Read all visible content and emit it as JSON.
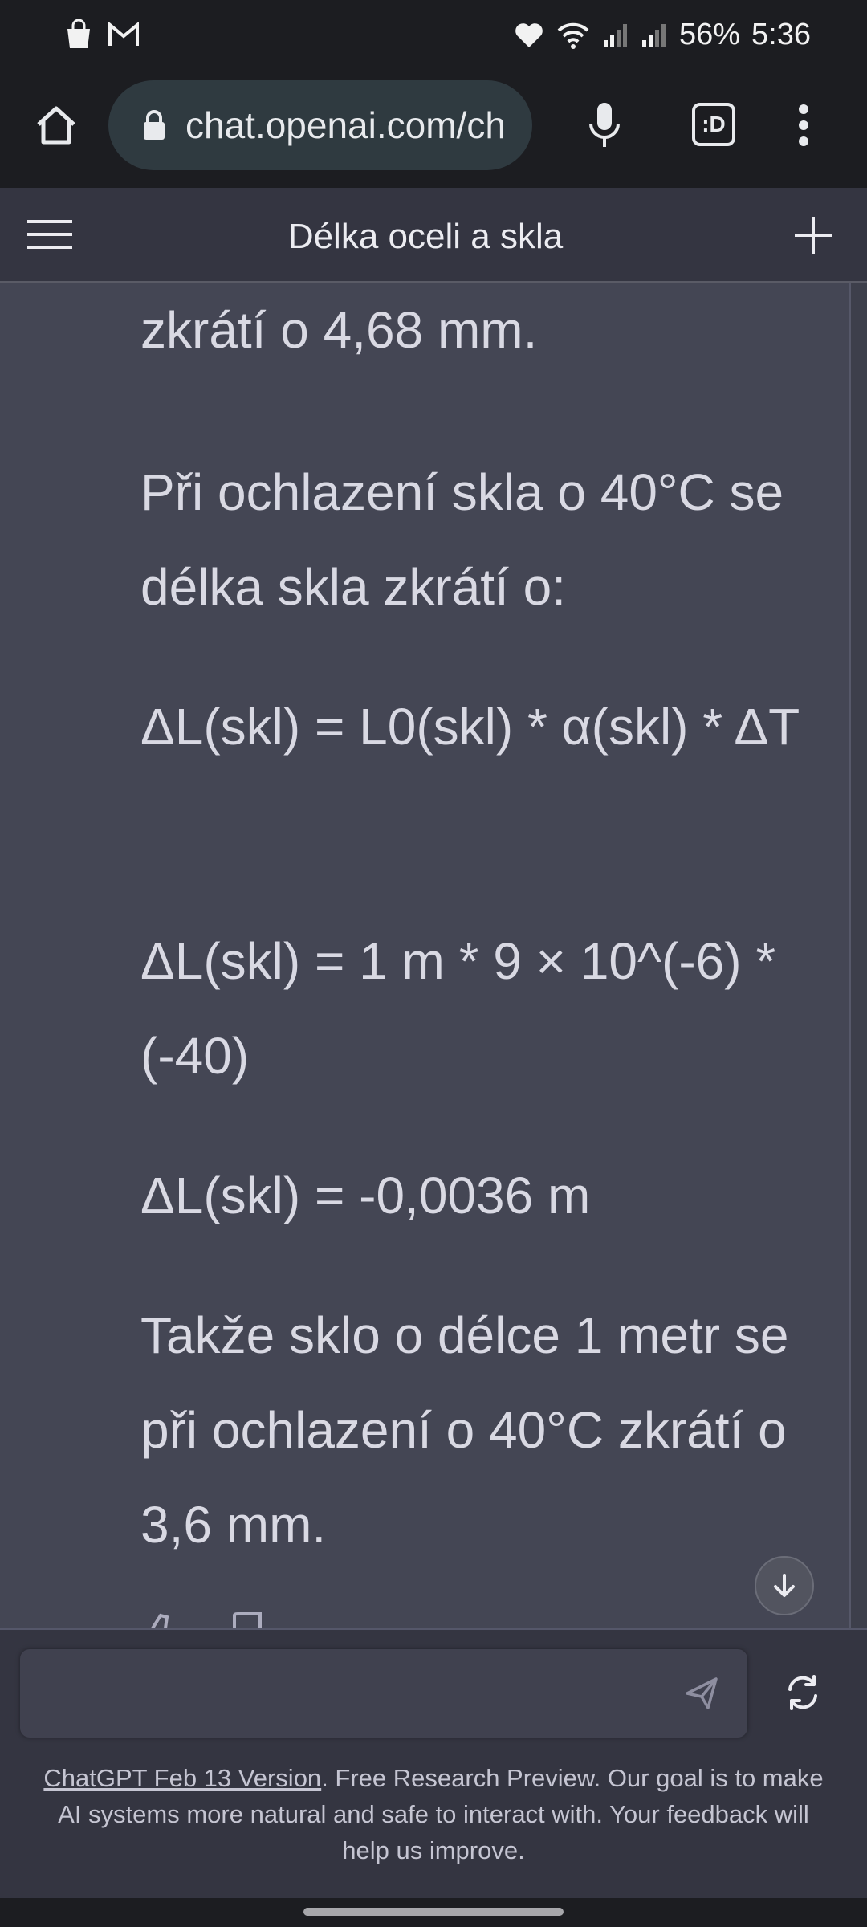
{
  "status_bar": {
    "battery": "56%",
    "time": "5:36"
  },
  "browser": {
    "url": "chat.openai.com/ch",
    "tabs_icon_label": ":D"
  },
  "chat": {
    "title": "Délka oceli a skla"
  },
  "message": {
    "paragraphs": [
      "zkrátí o 4,68 mm.",
      "Při ochlazení skla o 40°C se délka skla zkrátí o:",
      "ΔL(skl) = L0(skl) * α(skl) * ΔT",
      "ΔL(skl) = 1 m * 9 × 10^(-6) * (-40)",
      "ΔL(skl) = -0,0036 m",
      "Takže sklo o délce 1 metr se při ochlazení o 40°C zkrátí o 3,6 mm."
    ]
  },
  "footer": {
    "version_link": "ChatGPT Feb 13 Version",
    "text": ". Free Research Preview. Our goal is to make AI systems more natural and safe to interact with. Your feedback will help us improve."
  },
  "colors": {
    "background": "#444654",
    "header": "#343541",
    "browser_chrome": "#1c1d21"
  }
}
